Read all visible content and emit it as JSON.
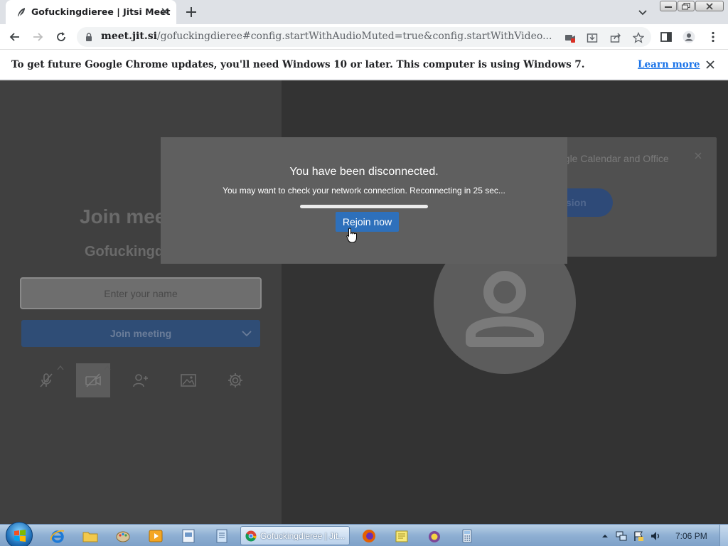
{
  "browser": {
    "tab_title": "Gofuckingdieree | Jitsi Meet",
    "url_host": "meet.jit.si",
    "url_path": "/gofuckingdieree#config.startWithAudioMuted=true&config.startWithVideo..."
  },
  "infobar": {
    "message": "To get future Google Chrome updates, you'll need Windows 10 or later. This computer is using Windows 7.",
    "link_label": "Learn more"
  },
  "prejoin": {
    "title": "Join meeting",
    "room_name": "Gofuckingdieree",
    "name_placeholder": "Enter your name",
    "join_label": "Join meeting"
  },
  "notification": {
    "text": "ogle Calendar and Office",
    "button_label": "sion"
  },
  "dialog": {
    "heading": "You have been disconnected.",
    "message": "You may want to check your network connection. Reconnecting in 25 sec...",
    "rejoin_label": "Rejoin now"
  },
  "taskbar": {
    "chrome_label": "Gofuckingdieree | Jit...",
    "clock": "7:06 PM"
  },
  "colors": {
    "accent": "#2e70bb",
    "taskbar": "#8fb0d3"
  }
}
